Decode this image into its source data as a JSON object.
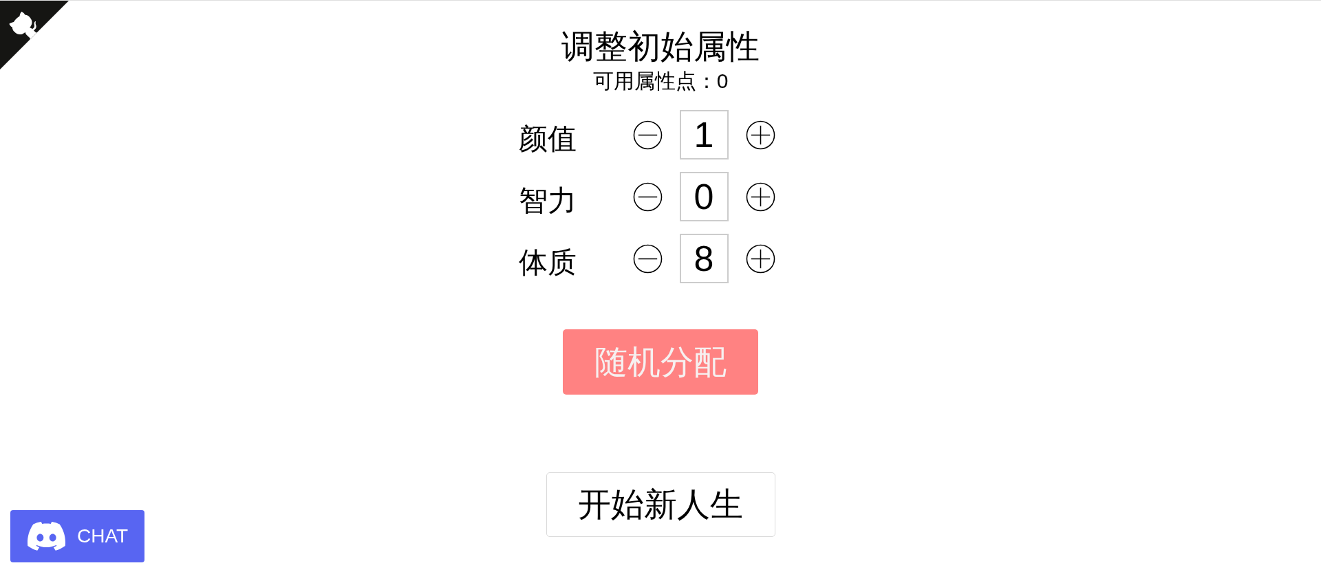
{
  "title": "调整初始属性",
  "available_points": "可用属性点：0",
  "attributes": [
    {
      "label": "颜值",
      "value": "1"
    },
    {
      "label": "智力",
      "value": "0"
    },
    {
      "label": "体质",
      "value": "8"
    }
  ],
  "random_button": "随机分配",
  "start_button": "开始新人生",
  "chat_button": "CHAT"
}
